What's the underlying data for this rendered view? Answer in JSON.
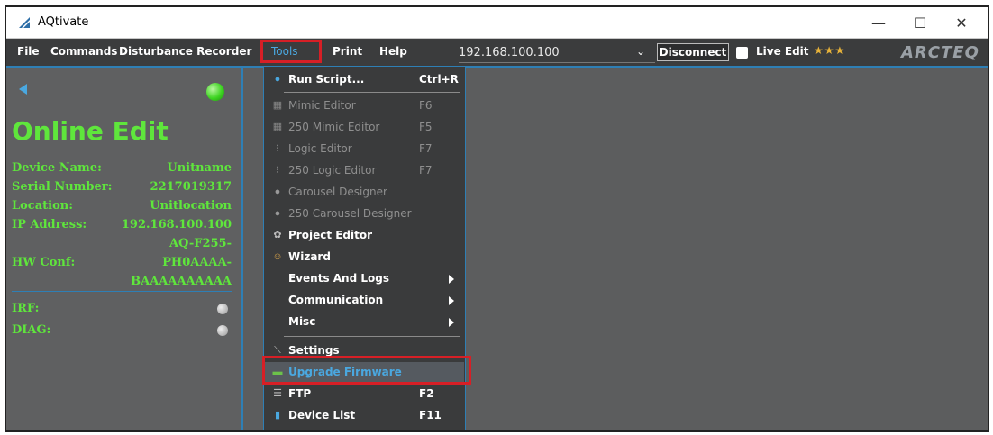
{
  "window": {
    "title": "AQtivate",
    "controls": {
      "minimize": "—",
      "maximize": "☐",
      "close": "✕"
    }
  },
  "menubar": {
    "items": [
      "File",
      "Commands",
      "Disturbance Recorder",
      "Tools",
      "Print",
      "Help"
    ],
    "ip_address": "192.168.100.100",
    "disconnect_label": "Disconnect",
    "live_edit_label": "Live Edit",
    "live_edit_checked": false,
    "stars": "★★★",
    "brand": "ARCTEQ"
  },
  "left_panel": {
    "title": "Online Edit",
    "fields": [
      {
        "label": "Device Name:",
        "value": "Unitname"
      },
      {
        "label": "Serial Number:",
        "value": "2217019317"
      },
      {
        "label": "Location:",
        "value": "Unitlocation"
      },
      {
        "label": "IP Address:",
        "value": "192.168.100.100"
      },
      {
        "label": "HW Conf:",
        "value_lines": [
          "AQ-F255-",
          "PH0AAAA-",
          "BAAAAAAAAAA"
        ]
      }
    ],
    "indicators": [
      {
        "label": "IRF:"
      },
      {
        "label": "DIAG:"
      }
    ]
  },
  "tools_menu": {
    "items": [
      {
        "label": "Run Script...",
        "shortcut": "Ctrl+R",
        "enabled": true,
        "icon": "script-icon"
      },
      {
        "label": "Mimic Editor",
        "shortcut": "F6",
        "enabled": false,
        "icon": "mimic-icon"
      },
      {
        "label": "250 Mimic Editor",
        "shortcut": "F5",
        "enabled": false,
        "icon": "mimic-icon"
      },
      {
        "label": "Logic Editor",
        "shortcut": "F7",
        "enabled": false,
        "icon": "logic-icon"
      },
      {
        "label": "250 Logic Editor",
        "shortcut": "F7",
        "enabled": false,
        "icon": "logic-icon"
      },
      {
        "label": "Carousel Designer",
        "shortcut": "",
        "enabled": false,
        "icon": "carousel-icon"
      },
      {
        "label": "250 Carousel Designer",
        "shortcut": "",
        "enabled": false,
        "icon": "carousel-icon"
      },
      {
        "label": "Project Editor",
        "shortcut": "",
        "enabled": true,
        "icon": "gear-icon"
      },
      {
        "label": "Wizard",
        "shortcut": "",
        "enabled": true,
        "icon": "wizard-icon"
      },
      {
        "label": "Events And Logs",
        "shortcut": "",
        "enabled": true,
        "submenu": true
      },
      {
        "label": "Communication",
        "shortcut": "",
        "enabled": true,
        "submenu": true
      },
      {
        "label": "Misc",
        "shortcut": "",
        "enabled": true,
        "submenu": true
      },
      {
        "label": "Settings",
        "shortcut": "",
        "enabled": true,
        "icon": "settings-icon"
      },
      {
        "label": "Upgrade Firmware",
        "shortcut": "",
        "enabled": true,
        "highlighted": true,
        "icon": "firmware-icon"
      },
      {
        "label": "FTP",
        "shortcut": "F2",
        "enabled": true,
        "icon": "ftp-icon"
      },
      {
        "label": "Device List",
        "shortcut": "F11",
        "enabled": true,
        "icon": "device-list-icon"
      }
    ]
  },
  "colors": {
    "accent": "#2e7fb5",
    "online_green": "#5fe63c",
    "highlight_red": "#d71f26",
    "menu_bg": "#3a3b3c"
  }
}
